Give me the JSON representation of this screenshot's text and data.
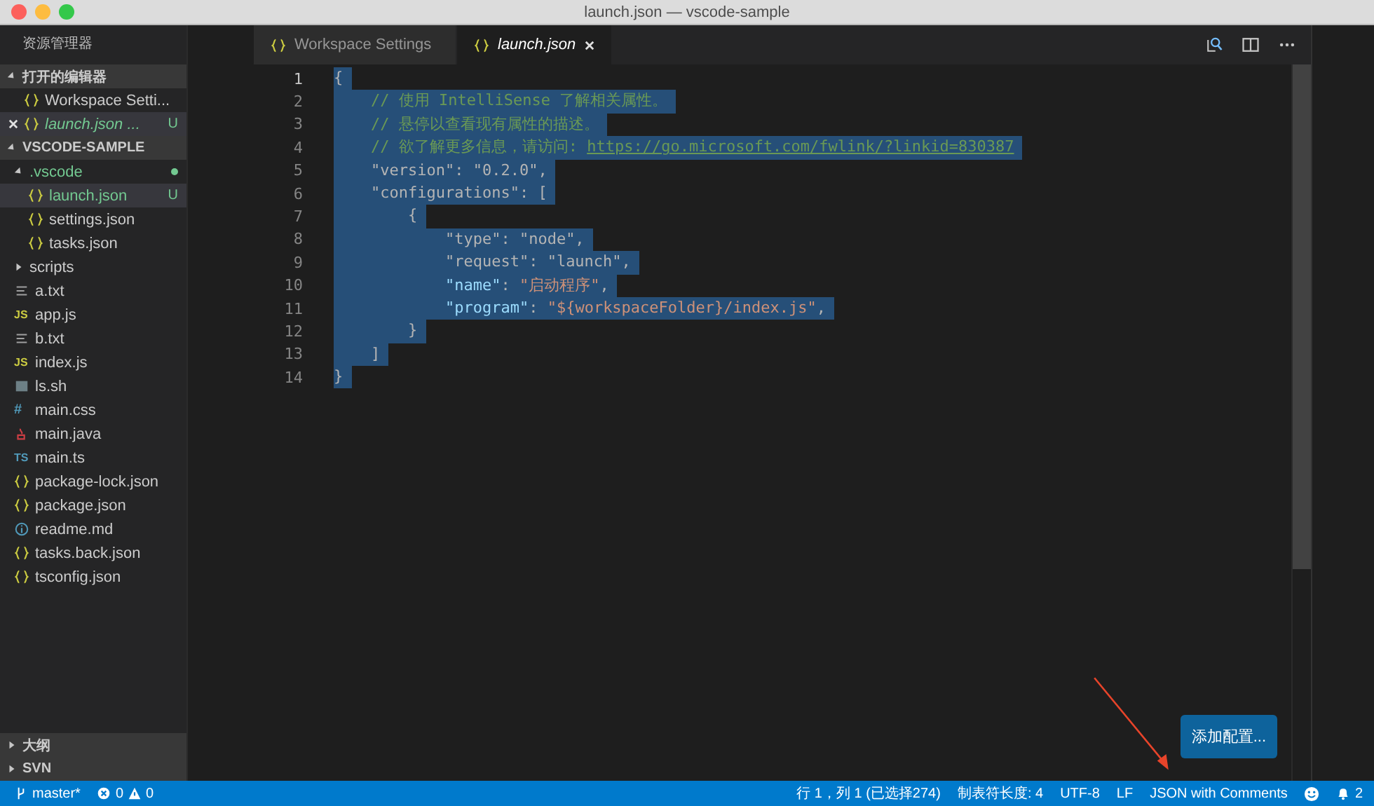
{
  "window": {
    "title": "launch.json — vscode-sample"
  },
  "sidebar": {
    "title": "资源管理器",
    "sections": [
      {
        "title": "打开的编辑器",
        "expanded": true,
        "open_editors": [
          {
            "label": "Workspace Setti...",
            "kind": "json",
            "selected": false,
            "preview": false,
            "modified": false
          },
          {
            "label": "launch.json ...",
            "kind": "json",
            "selected": true,
            "preview": true,
            "modified": true,
            "badge": "U"
          }
        ]
      },
      {
        "title": "VSCODE-SAMPLE",
        "expanded": true,
        "items": [
          {
            "label": ".vscode",
            "kind": "folder",
            "expanded": true,
            "modified": true,
            "dot": true,
            "selected": false,
            "children": [
              {
                "label": "launch.json",
                "kind": "json",
                "modified": true,
                "badge": "U",
                "selected": true
              },
              {
                "label": "settings.json",
                "kind": "json",
                "modified": false,
                "selected": false
              },
              {
                "label": "tasks.json",
                "kind": "json",
                "modified": false,
                "selected": false
              }
            ]
          },
          {
            "label": "scripts",
            "kind": "folder",
            "expanded": false,
            "modified": false,
            "selected": false
          },
          {
            "label": "a.txt",
            "kind": "txt",
            "modified": false,
            "selected": false
          },
          {
            "label": "app.js",
            "kind": "js",
            "icon_text": "JS",
            "modified": false,
            "selected": false
          },
          {
            "label": "b.txt",
            "kind": "txt",
            "modified": false,
            "selected": false
          },
          {
            "label": "index.js",
            "kind": "js",
            "icon_text": "JS",
            "modified": false,
            "selected": false
          },
          {
            "label": "ls.sh",
            "kind": "sh",
            "modified": false,
            "selected": false
          },
          {
            "label": "main.css",
            "kind": "css",
            "icon_text": "#",
            "modified": false,
            "selected": false
          },
          {
            "label": "main.java",
            "kind": "java",
            "modified": false,
            "selected": false
          },
          {
            "label": "main.ts",
            "kind": "ts",
            "icon_text": "TS",
            "modified": false,
            "selected": false
          },
          {
            "label": "package-lock.json",
            "kind": "json",
            "modified": false,
            "selected": false
          },
          {
            "label": "package.json",
            "kind": "json",
            "modified": false,
            "selected": false
          },
          {
            "label": "readme.md",
            "kind": "md",
            "modified": false,
            "selected": false
          },
          {
            "label": "tasks.back.json",
            "kind": "json",
            "modified": false,
            "selected": false
          },
          {
            "label": "tsconfig.json",
            "kind": "json",
            "modified": false,
            "selected": false
          }
        ]
      }
    ],
    "bottom_sections": [
      {
        "title": "大纲",
        "expanded": false
      },
      {
        "title": "SVN",
        "expanded": false
      }
    ]
  },
  "tabs": [
    {
      "label": "Workspace Settings",
      "selected": false,
      "preview": false
    },
    {
      "label": "launch.json",
      "selected": true,
      "preview": true
    }
  ],
  "editor": {
    "lines": [
      {
        "number": "1",
        "selected": true,
        "tokens": [
          {
            "kind": "text",
            "text": "{"
          }
        ]
      },
      {
        "number": "2",
        "selected": true,
        "tokens": [
          {
            "kind": "comment",
            "text": "    // 使用 IntelliSense 了解相关属性。"
          }
        ]
      },
      {
        "number": "3",
        "selected": true,
        "tokens": [
          {
            "kind": "comment",
            "text": "    // 悬停以查看现有属性的描述。"
          }
        ]
      },
      {
        "number": "4",
        "selected": true,
        "tokens": [
          {
            "kind": "comment",
            "text": "    // 欲了解更多信息，请访问: "
          },
          {
            "kind": "link",
            "text": "https://go.microsoft.com/fwlink/?linkid=830387"
          }
        ]
      },
      {
        "number": "5",
        "selected": true,
        "tokens": [
          {
            "kind": "text",
            "text": "    \"version\": \"0.2.0\","
          }
        ]
      },
      {
        "number": "6",
        "selected": true,
        "tokens": [
          {
            "kind": "text",
            "text": "    \"configurations\": ["
          }
        ]
      },
      {
        "number": "7",
        "selected": true,
        "tokens": [
          {
            "kind": "text",
            "text": "        {"
          }
        ]
      },
      {
        "number": "8",
        "selected": true,
        "tokens": [
          {
            "kind": "text",
            "text": "            \"type\": \"node\","
          }
        ]
      },
      {
        "number": "9",
        "selected": true,
        "tokens": [
          {
            "kind": "text",
            "text": "            \"request\": \"launch\","
          }
        ]
      },
      {
        "number": "10",
        "selected": true,
        "tokens": [
          {
            "kind": "key",
            "text": "            \"name\""
          },
          {
            "kind": "text",
            "text": ": "
          },
          {
            "kind": "string",
            "text": "\"启动程序\""
          },
          {
            "kind": "text",
            "text": ","
          }
        ]
      },
      {
        "number": "11",
        "selected": true,
        "tokens": [
          {
            "kind": "key",
            "text": "            \"program\""
          },
          {
            "kind": "text",
            "text": ": "
          },
          {
            "kind": "string",
            "text": "\"${workspaceFolder}/index.js\""
          },
          {
            "kind": "text",
            "text": ","
          }
        ]
      },
      {
        "number": "12",
        "selected": true,
        "tokens": [
          {
            "kind": "text",
            "text": "        }"
          }
        ]
      },
      {
        "number": "13",
        "selected": true,
        "tokens": [
          {
            "kind": "text",
            "text": "    ]"
          }
        ]
      },
      {
        "number": "14",
        "selected": true,
        "tokens": [
          {
            "kind": "text",
            "text": "}"
          }
        ]
      }
    ],
    "action_button": "添加配置..."
  },
  "status_bar": {
    "branch": "master*",
    "errors": "0",
    "warnings": "0",
    "right": [
      "行 1，列 1 (已选择274)",
      "制表符长度: 4",
      "UTF-8",
      "LF",
      "JSON with Comments"
    ],
    "notifications": "2"
  }
}
